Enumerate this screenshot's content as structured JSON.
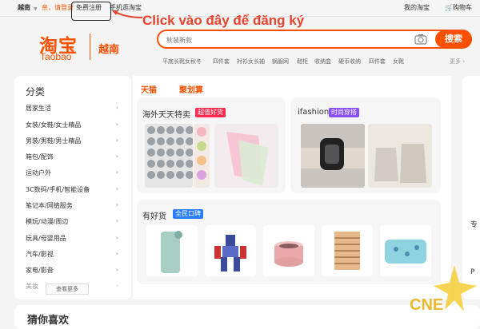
{
  "topbar": {
    "location": "越南",
    "login": "亲，请登录",
    "register": "免费注册",
    "mobile": "手机逛淘宝",
    "my_taobao": "我的淘宝",
    "cart": "购物车"
  },
  "annotation": {
    "text": "Click vào đây để đăng ký",
    "color": "#e8432d"
  },
  "header": {
    "logo_cn": "淘宝",
    "logo_en": "Taobao",
    "region": "越南",
    "search_placeholder": "秋装新款",
    "search_button": "搜索",
    "hot_words": [
      "平底长靴女秋冬",
      "四件套",
      "衬衫女长袖",
      "锅服网",
      "鞋柜",
      "收纳盒",
      "硬币收纳",
      "四件套",
      "女靴"
    ],
    "more": "更多 ›",
    "accent": "#ff5000"
  },
  "categories": {
    "title": "分类",
    "items": [
      "居家生活",
      "女装/女鞋/女士精品",
      "男装/男鞋/男士精品",
      "箱包/配饰",
      "运动户外",
      "3C数码/手机/智能设备",
      "笔记本/网络服务",
      "模玩/动漫/周边",
      "玩具/母婴用品",
      "汽车/影视",
      "家电/影音",
      "美妆"
    ],
    "see_more": "查看更多"
  },
  "tabs": [
    "天猫",
    "聚划算"
  ],
  "cards": {
    "overseas": {
      "title": "海外天天特卖",
      "badge": "超值好货",
      "badge_color": "#ff2a4d"
    },
    "ifashion": {
      "title": "ifashion",
      "badge": "时尚穿搭",
      "badge_color": "#8a4dff"
    },
    "good": {
      "title": "有好货",
      "badge": "全民口碑",
      "badge_color": "#2a7cff"
    }
  },
  "right_strip": {
    "chars": [
      "专",
      "P"
    ]
  },
  "bottom": {
    "title": "猜你喜欢"
  },
  "watermark": {
    "text": "CNE"
  }
}
